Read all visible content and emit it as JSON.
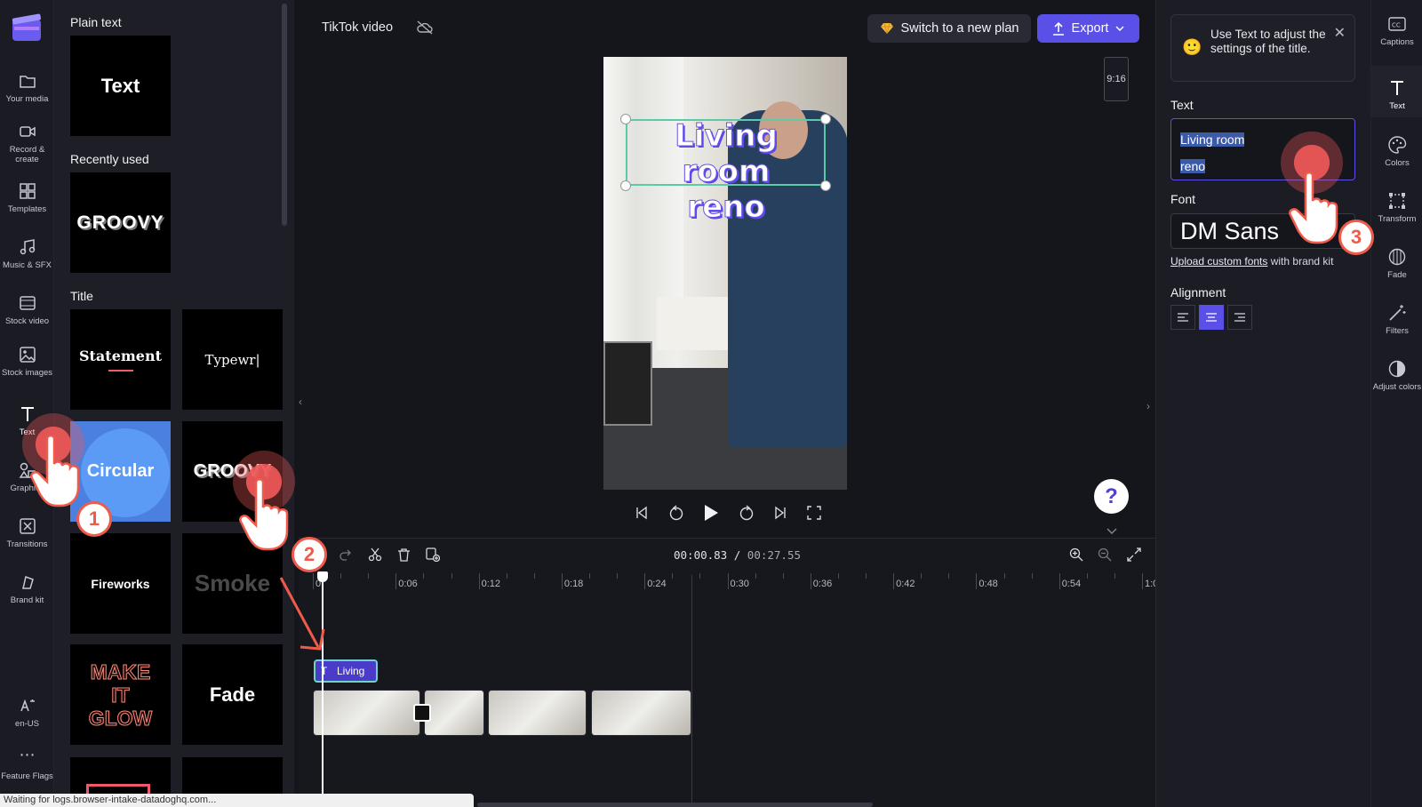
{
  "left_nav": {
    "items": [
      {
        "label": "Your media"
      },
      {
        "label": "Record & create"
      },
      {
        "label": "Templates"
      },
      {
        "label": "Music & SFX"
      },
      {
        "label": "Stock video"
      },
      {
        "label": "Stock images"
      },
      {
        "label": "Text"
      },
      {
        "label": "Graphics"
      },
      {
        "label": "Transitions"
      },
      {
        "label": "Brand kit"
      },
      {
        "label": "en-US"
      },
      {
        "label": "Feature Flags"
      }
    ]
  },
  "library": {
    "sections": {
      "plain_text": "Plain text",
      "recently_used": "Recently used",
      "title": "Title"
    },
    "tiles": {
      "plain": "Text",
      "recent": "GROOVY",
      "statement": "Statement",
      "typewriter": "Typewr",
      "circular": "Circular",
      "groovy": "GROOVY",
      "fireworks": "Fireworks",
      "smoke": "Smoke",
      "make_it_glow": "MAKE IT GLOW",
      "fade": "Fade"
    }
  },
  "topbar": {
    "project_title": "TikTok video",
    "plan_button": "Switch to a new plan",
    "export_button": "Export"
  },
  "preview": {
    "aspect_ratio": "9:16",
    "title_line1": "Living room",
    "title_line2": "reno"
  },
  "timeline": {
    "current_time": "00:00.83",
    "separator": " / ",
    "total_time": "00:27.55",
    "ruler_ticks": [
      "0",
      "0:06",
      "0:12",
      "0:18",
      "0:24",
      "0:30",
      "0:36",
      "0:42",
      "0:48",
      "0:54",
      "1:0"
    ],
    "text_clip_label": "Living"
  },
  "properties": {
    "tip": "Use Text to adjust the settings of the title.",
    "text_label": "Text",
    "text_value_line1": "Living room",
    "text_value_line2": "reno",
    "font_label": "Font",
    "font_value": "DM Sans",
    "upload_link": "Upload custom fonts",
    "upload_suffix": " with brand kit",
    "alignment_label": "Alignment",
    "alignment_selected": "center"
  },
  "right_tools": {
    "items": [
      {
        "label": "Captions"
      },
      {
        "label": "Text"
      },
      {
        "label": "Colors"
      },
      {
        "label": "Transform"
      },
      {
        "label": "Fade"
      },
      {
        "label": "Filters"
      },
      {
        "label": "Adjust colors"
      }
    ]
  },
  "tutorial": {
    "steps": [
      "1",
      "2",
      "3"
    ]
  },
  "status_bar": "Waiting for logs.browser-intake-datadoghq.com..."
}
